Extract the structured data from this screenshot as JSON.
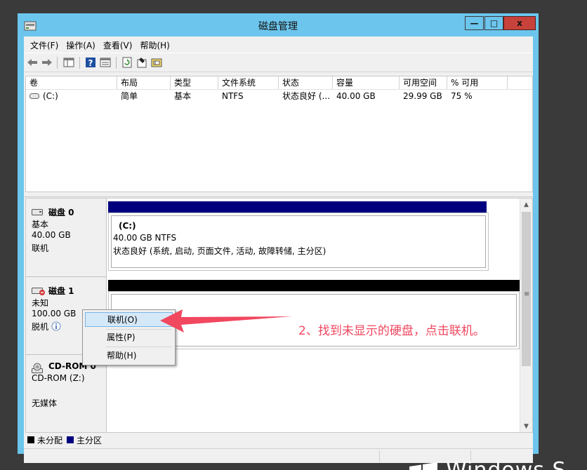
{
  "window": {
    "title": "磁盘管理",
    "controls": {
      "minimize": "—",
      "maximize": "□",
      "close": "x"
    }
  },
  "menubar": [
    "文件(F)",
    "操作(A)",
    "查看(V)",
    "帮助(H)"
  ],
  "toolbar": {
    "icons": [
      "back-arrow-icon",
      "forward-arrow-icon",
      "show-hide-console-tree-icon",
      "help-icon",
      "export-list-icon",
      "refresh-icon",
      "properties-icon",
      "rescan-disks-icon"
    ]
  },
  "volume_list": {
    "columns": [
      "卷",
      "布局",
      "类型",
      "文件系统",
      "状态",
      "容量",
      "可用空间",
      "% 可用"
    ],
    "rows": [
      [
        "(C:)",
        "简单",
        "基本",
        "NTFS",
        "状态良好 (...",
        "40.00 GB",
        "29.99 GB",
        "75 %"
      ]
    ]
  },
  "disks": [
    {
      "name": "磁盘 0",
      "type": "基本",
      "size": "40.00 GB",
      "status": "联机",
      "partition": {
        "title": "(C:)",
        "size": "40.00 GB NTFS",
        "status": "状态良好 (系统, 启动, 页面文件, 活动, 故障转储, 主分区)"
      }
    },
    {
      "name": "磁盘 1",
      "type": "未知",
      "size": "100.00 GB",
      "status": "脱机"
    },
    {
      "name": "CD-ROM 0",
      "type": "CD-ROM (Z:)",
      "media": "无媒体"
    }
  ],
  "context_menu": [
    "联机(O)",
    "属性(P)",
    "帮助(H)"
  ],
  "legend": [
    {
      "label": "未分配",
      "color": "#000000"
    },
    {
      "label": "主分区",
      "color": "#00007f"
    }
  ],
  "annotation": "2、找到未显示的硬盘，点击联机。",
  "colors": {
    "titlebar": "#6cc5ec",
    "primary_partition": "#00007f",
    "unallocated": "#000000",
    "annotation": "#f1475f"
  },
  "branding": {
    "text": "Windows S"
  }
}
